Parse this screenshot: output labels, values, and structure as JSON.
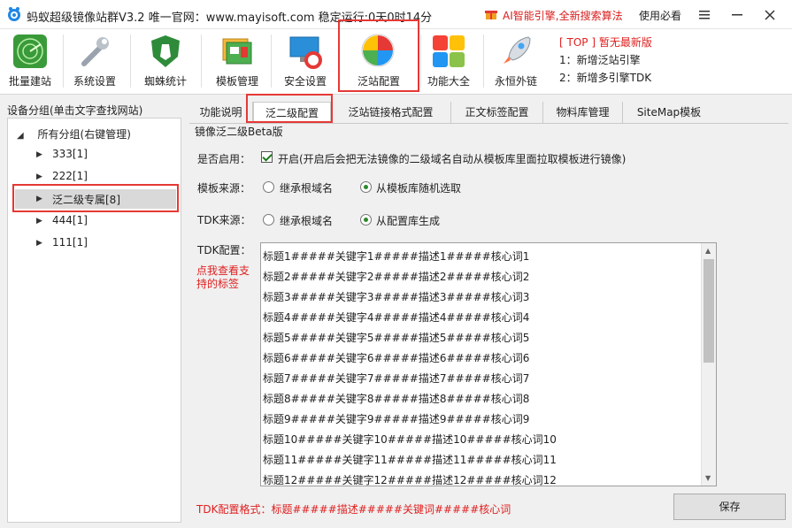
{
  "titlebar": {
    "title": "蚂蚁超级镜像站群V3.2  唯一官网：www.mayisoft.com  稳定运行:0天0时14分",
    "promo": "AI智能引擎,全新搜索算法",
    "help": "使用必看"
  },
  "toolbar": {
    "items": [
      {
        "label": "批量建站",
        "icon": "radar-icon"
      },
      {
        "label": "系统设置",
        "icon": "wrench-icon"
      },
      {
        "label": "蜘蛛统计",
        "icon": "shield-horse-icon"
      },
      {
        "label": "模板管理",
        "icon": "template-icon"
      },
      {
        "label": "安全设置",
        "icon": "monitor-lifebuoy-icon"
      },
      {
        "label": "泛站配置",
        "icon": "colorful-globe-icon"
      },
      {
        "label": "功能大全",
        "icon": "apps-grid-icon"
      },
      {
        "label": "永恒外链",
        "icon": "rocket-icon"
      }
    ],
    "news": {
      "headline": "[ TOP ] 暂无最新版",
      "line1": "1：新增泛站引擎",
      "line2": "2：新增多引擎TDK"
    }
  },
  "sidebar": {
    "title": "设备分组(单击文字查找网站)",
    "root": "所有分组(右键管理)",
    "items": [
      {
        "label": "333[1]"
      },
      {
        "label": "222[1]"
      },
      {
        "label": "泛二级专属[8]"
      },
      {
        "label": "444[1]"
      },
      {
        "label": "111[1]"
      }
    ]
  },
  "tabs": [
    "功能说明",
    "泛二级配置",
    "泛站链接格式配置",
    "正文标签配置",
    "物料库管理",
    "SiteMap模板"
  ],
  "form": {
    "section_title": "镜像泛二级Beta版",
    "enable_label": "是否启用：",
    "enable_text": "开启(开启后会把无法镜像的二级域名自动从模板库里面拉取模板进行镜像)",
    "template_label": "模板来源：",
    "template_opt1": "继承根域名",
    "template_opt2": "从模板库随机选取",
    "tdk_source_label": "TDK来源：",
    "tdk_opt1": "继承根域名",
    "tdk_opt2": "从配置库生成",
    "tdk_config_label": "TDK配置：",
    "tdk_help_link": "点我查看支持的标签",
    "tdk_lines": [
      "标题1#####关键字1#####描述1#####核心词1",
      "标题2#####关键字2#####描述2#####核心词2",
      "标题3#####关键字3#####描述3#####核心词3",
      "标题4#####关键字4#####描述4#####核心词4",
      "标题5#####关键字5#####描述5#####核心词5",
      "标题6#####关键字6#####描述6#####核心词6",
      "标题7#####关键字7#####描述7#####核心词7",
      "标题8#####关键字8#####描述8#####核心词8",
      "标题9#####关键字9#####描述9#####核心词9",
      "标题10#####关键字10#####描述10#####核心词10",
      "标题11#####关键字11#####描述11#####核心词11",
      "标题12#####关键字12#####描述12#####核心词12"
    ],
    "format_hint": "TDK配置格式：标题#####描述#####关键词#####核心词",
    "save_label": "保存"
  },
  "colors": {
    "accent_red": "#e53935",
    "hint_red": "#e02020",
    "check_green": "#2a8a2a"
  }
}
